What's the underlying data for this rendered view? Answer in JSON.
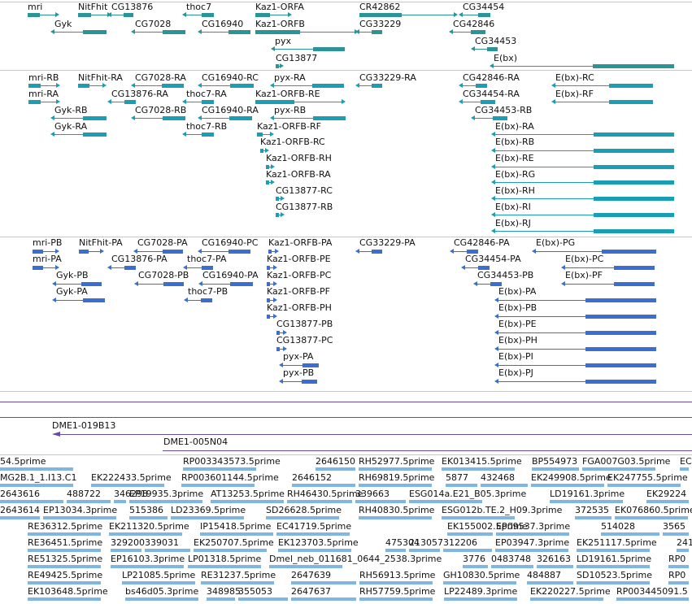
{
  "colors": {
    "gene": "#2a9496",
    "transcript_rna": "#199eb4",
    "transcript_protein": "#3a6fcf",
    "clone": "#6a4aa8",
    "est": "#7fb6e4",
    "separator": "#c8c8c8"
  },
  "genes_track": {
    "labels": {
      "mri": "mri",
      "nitfhit": "NitFhit",
      "cg13876": "CG13876",
      "thoc7": "thoc7",
      "kaz1_orfa": "Kaz1-ORFA",
      "cr42862": "CR42862",
      "cg34454": "CG34454",
      "gyk": "Gyk",
      "cg7028": "CG7028",
      "cg16940": "CG16940",
      "kaz1_orfb": "Kaz1-ORFB",
      "cg33229": "CG33229",
      "cg42846": "CG42846",
      "pyx": "pyx",
      "cg34453": "CG34453",
      "cg13877": "CG13877",
      "ebx": "E(bx)"
    }
  },
  "rna_track": {
    "labels": {
      "mri_rb": "mri-RB",
      "nitfhit_ra": "NitFhit-RA",
      "cg7028_ra": "CG7028-RA",
      "cg16940_rc": "CG16940-RC",
      "pyx_ra": "pyx-RA",
      "cg33229_ra": "CG33229-RA",
      "cg42846_ra": "CG42846-RA",
      "ebx_rc": "E(bx)-RC",
      "mri_ra": "mri-RA",
      "cg13876_ra": "CG13876-RA",
      "thoc7_ra": "thoc7-RA",
      "kaz1_orfb_re": "Kaz1-ORFB-RE",
      "cg34454_ra": "CG34454-RA",
      "ebx_rf": "E(bx)-RF",
      "gyk_rb": "Gyk-RB",
      "cg7028_rb": "CG7028-RB",
      "cg16940_ra": "CG16940-RA",
      "pyx_rb": "pyx-RB",
      "cg34453_rb": "CG34453-RB",
      "gyk_ra": "Gyk-RA",
      "thoc7_rb": "thoc7-RB",
      "kaz1_orfb_rf": "Kaz1-ORFB-RF",
      "ebx_ra": "E(bx)-RA",
      "kaz1_orfb_rc": "Kaz1-ORFB-RC",
      "ebx_rb": "E(bx)-RB",
      "kaz1_orfb_rh": "Kaz1-ORFB-RH",
      "ebx_re": "E(bx)-RE",
      "kaz1_orfb_ra": "Kaz1-ORFB-RA",
      "ebx_rg": "E(bx)-RG",
      "cg13877_rc": "CG13877-RC",
      "ebx_rh": "E(bx)-RH",
      "cg13877_rb": "CG13877-RB",
      "ebx_ri": "E(bx)-RI",
      "ebx_rj": "E(bx)-RJ"
    }
  },
  "protein_track": {
    "labels": {
      "mri_pb": "mri-PB",
      "nitfhit_pa": "NitFhit-PA",
      "cg7028_pa": "CG7028-PA",
      "cg16940_pc": "CG16940-PC",
      "kaz1_orfb_pa": "Kaz1-ORFB-PA",
      "cg33229_pa": "CG33229-PA",
      "cg42846_pa": "CG42846-PA",
      "ebx_pg": "E(bx)-PG",
      "mri_pa": "mri-PA",
      "cg13876_pa": "CG13876-PA",
      "thoc7_pa": "thoc7-PA",
      "kaz1_orfb_pe": "Kaz1-ORFB-PE",
      "cg34454_pa": "CG34454-PA",
      "ebx_pc": "E(bx)-PC",
      "gyk_pb": "Gyk-PB",
      "cg7028_pb": "CG7028-PB",
      "cg16940_pa": "CG16940-PA",
      "kaz1_orfb_pc": "Kaz1-ORFB-PC",
      "cg34453_pb": "CG34453-PB",
      "ebx_pf": "E(bx)-PF",
      "gyk_pa": "Gyk-PA",
      "thoc7_pb": "thoc7-PB",
      "kaz1_orfb_pf": "Kaz1-ORFB-PF",
      "ebx_pa": "E(bx)-PA",
      "kaz1_orfb_ph": "Kaz1-ORFB-PH",
      "ebx_pb": "E(bx)-PB",
      "cg13877_pb": "CG13877-PB",
      "ebx_pe": "E(bx)-PE",
      "cg13877_pc": "CG13877-PC",
      "ebx_ph": "E(bx)-PH",
      "pyx_pa": "pyx-PA",
      "ebx_pi": "E(bx)-PI",
      "pyx_pb": "pyx-PB",
      "ebx_pj": "E(bx)-PJ"
    }
  },
  "clones_track": {
    "labels": {
      "c1": "DME1-019B13",
      "c2": "DME1-005N04"
    }
  },
  "est_track": {
    "rows": [
      [
        "54.5prime",
        "RP003343573.5prime",
        "2646150",
        "RH52977.5prime",
        "EK013415.5prime",
        "BP554973",
        "FGA007G03.5prime",
        "EC"
      ],
      [
        "MG2B.1_1.I13.C1",
        "EK222433.5prime",
        "RP003601144.5prime",
        "2646152",
        "RH69819.5prime",
        "5877",
        "432468",
        "EK249908.5prime",
        "EK247755.5prime"
      ],
      [
        "2643616",
        "488722",
        "346298",
        "EP19935.3prime",
        "AT13253.5prime",
        "RH46430.5prime",
        "339663",
        "ESG014a.E21_B05.3prime",
        "LD19161.3prime",
        "EK29224"
      ],
      [
        "2643614",
        "EP13034.3prime",
        "515386",
        "LD23369.5prime",
        "SD26628.5prime",
        "RH40830.5prime",
        "ESG012b.TE.2_H09.3prime",
        "372535",
        "EK076860.5prime"
      ],
      [
        "RE36312.5prime",
        "EK211320.5prime",
        "IP15418.5prime",
        "EC41719.5prime",
        "EK155002.5prime",
        "EP09537.3prime",
        "514028",
        "3565"
      ],
      [
        "RE36451.5prime",
        "329200",
        "339031",
        "EK250707.5prime",
        "EK123703.5prime",
        "475304",
        "213057",
        "312206",
        "EP03947.3prime",
        "EK251117.5prime",
        "2410"
      ],
      [
        "RE51325.5prime",
        "EP16103.3prime",
        "LP01318.5prime",
        "Dmel_neb_011681_0644_2538.3prime",
        "3776",
        "0483748",
        "326163",
        "LD19161.5prime",
        "RP0"
      ],
      [
        "RE49425.5prime",
        "LP21085.5prime",
        "RE31237.5prime",
        "2647639",
        "RH56913.5prime",
        "GH10830.5prime",
        "484887",
        "SD10523.5prime",
        "RP0"
      ],
      [
        "EK103648.5prime",
        "bs46d05.3prime",
        "348985",
        "355053",
        "2647637",
        "RH57759.5prime",
        "LP22489.3prime",
        "EK220227.5prime",
        "RP003445091.5"
      ]
    ]
  }
}
